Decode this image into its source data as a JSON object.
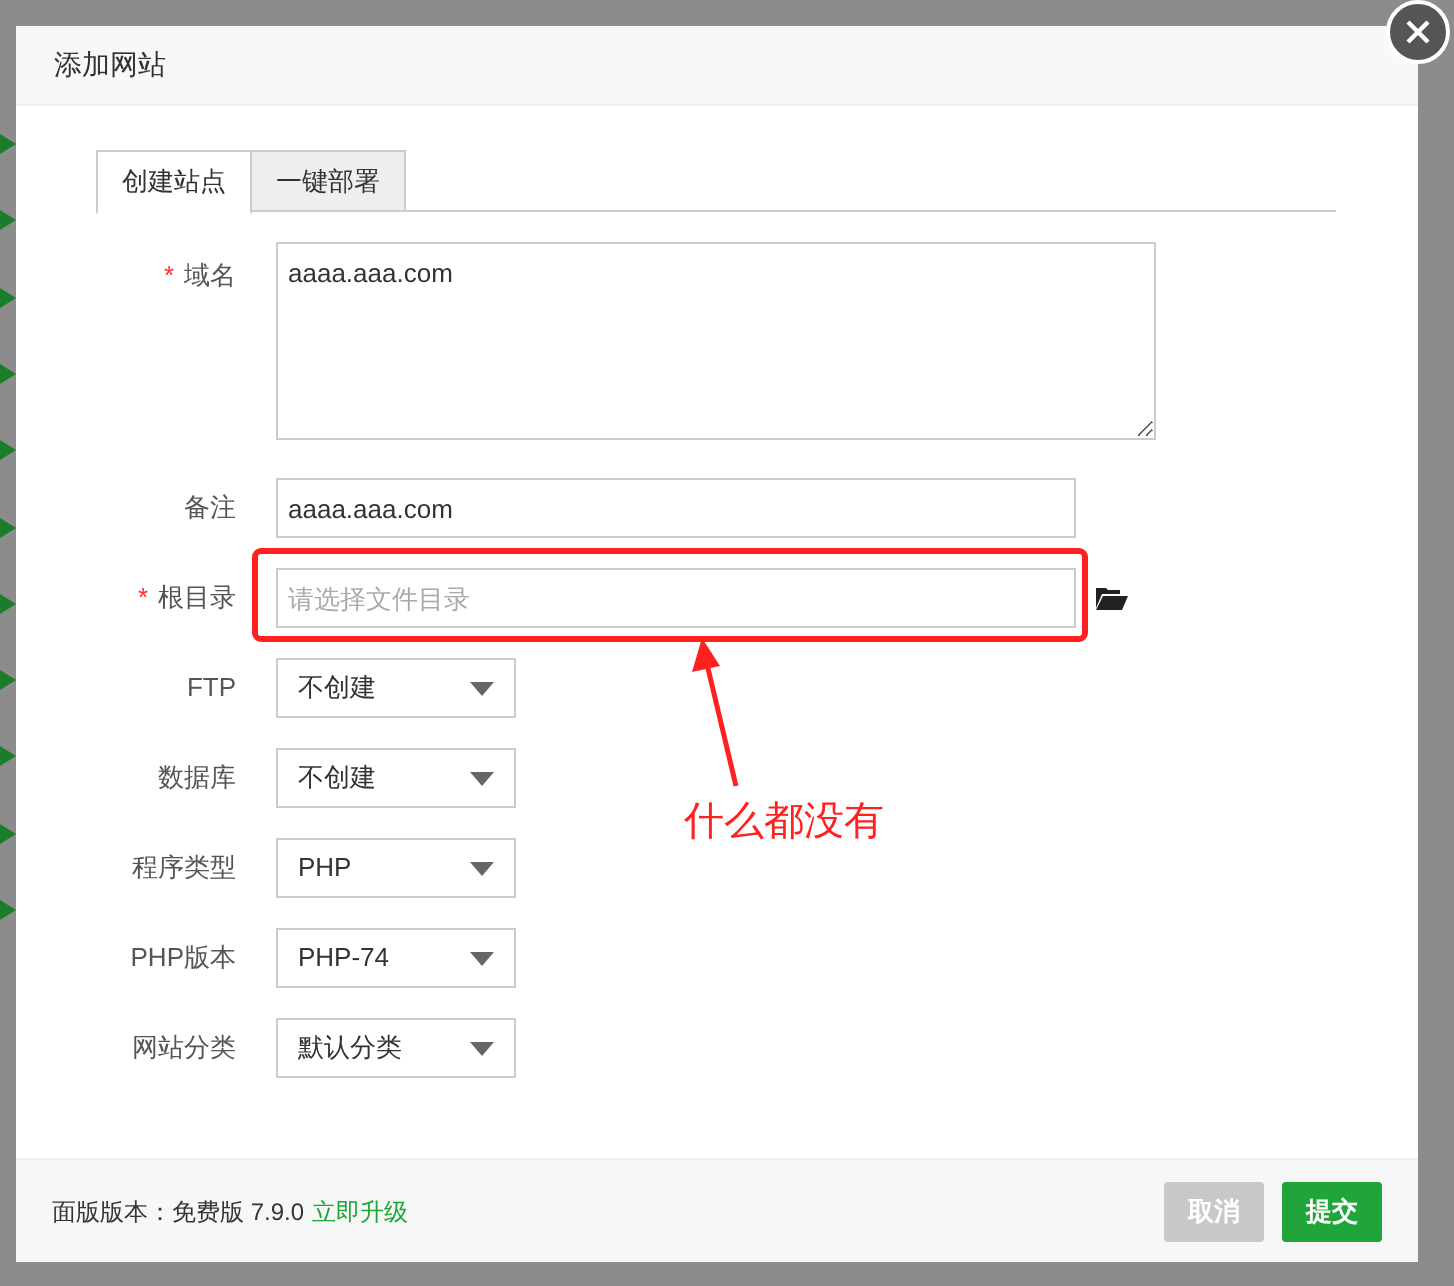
{
  "dialog": {
    "title": "添加网站"
  },
  "tabs": [
    {
      "label": "创建站点",
      "selected": true
    },
    {
      "label": "一键部署",
      "selected": false
    }
  ],
  "fields": [
    {
      "kind": "textarea",
      "label": "域名",
      "required_mark": "*",
      "value": "aaaa.aaa.com"
    },
    {
      "kind": "input",
      "label": "备注",
      "value": "aaaa.aaa.com"
    },
    {
      "kind": "path",
      "label": "根目录",
      "required_mark": "*",
      "placeholder": "请选择文件目录"
    },
    {
      "kind": "select",
      "label": "FTP",
      "value": "不创建"
    },
    {
      "kind": "select",
      "label": "数据库",
      "value": "不创建"
    },
    {
      "kind": "select",
      "label": "程序类型",
      "value": "PHP"
    },
    {
      "kind": "select",
      "label": "PHP版本",
      "value": "PHP-74"
    },
    {
      "kind": "select",
      "label": "网站分类",
      "value": "默认分类"
    }
  ],
  "annotation": {
    "text": "什么都没有"
  },
  "footer": {
    "version": "面版版本：免费版 7.9.0",
    "upgrade_link": "立即升级",
    "buttons": [
      {
        "label": "取消",
        "disabled": true
      },
      {
        "label": "提交",
        "disabled": false
      }
    ]
  }
}
